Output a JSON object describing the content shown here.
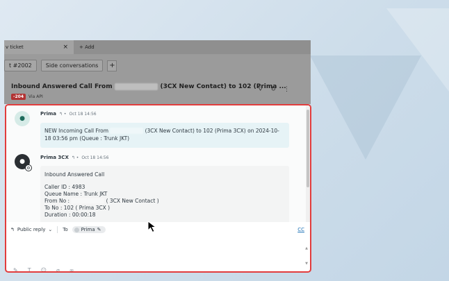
{
  "tabs": {
    "active_label": "v ticket",
    "close_glyph": "×",
    "add_label": "+ Add"
  },
  "subbar": {
    "ticket_pill": "t #2002",
    "side_conversations": "Side conversations",
    "plus": "+"
  },
  "ticket": {
    "title_prefix": "Inbound Answered Call From",
    "title_redacted": "0000000000",
    "title_suffix": "(3CX New Contact) to 102 (Prima ...",
    "badge": "-204",
    "via": "Via API",
    "icons": [
      "filter-icon",
      "history-icon",
      "more-icon"
    ]
  },
  "messages": [
    {
      "sender": "Prima",
      "time": "Oct 18 14:56",
      "text_prefix": "NEW Incoming Call From",
      "text_redacted": "0000000000",
      "text_suffix": "(3CX New Contact) to 102 (Prima 3CX) on 2024-10-18 03:56 pm (Queue : Trunk JKT)"
    },
    {
      "sender": "Prima 3CX",
      "time": "Oct 18 14:56",
      "heading": "Inbound Answered Call",
      "caller_id": "Caller ID : 4983",
      "queue_name": "Queue Name : Trunk JKT",
      "from_prefix": "From No :",
      "from_redacted": "0000000000",
      "from_suffix": "( 3CX New Contact )",
      "to_no": "To No : 102 ( Prima 3CX )",
      "duration": "Duration : 00:00:18"
    }
  ],
  "reply": {
    "mode": "Public reply",
    "to_label": "To",
    "recipient": "Prima",
    "cc": "CC"
  },
  "colors": {
    "highlight_border": "#e23c3c",
    "link": "#1f73b7",
    "badge_bg": "#b23232"
  }
}
